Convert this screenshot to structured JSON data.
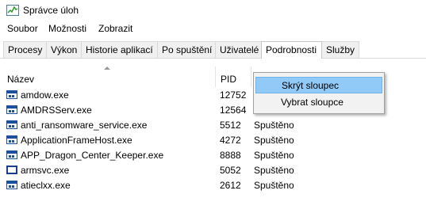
{
  "window": {
    "title": "Správce úloh"
  },
  "menu": [
    "Soubor",
    "Možnosti",
    "Zobrazit"
  ],
  "tabs": [
    "Procesy",
    "Výkon",
    "Historie aplikací",
    "Po spuštění",
    "Uživatelé",
    "Podrobnosti",
    "Služby"
  ],
  "active_tab": "Podrobnosti",
  "columns": {
    "name": "Název",
    "pid": "PID"
  },
  "context_menu": {
    "items": [
      "Skrýt sloupec",
      "Vybrat sloupce"
    ],
    "highlighted": "Skrýt sloupec"
  },
  "rows": [
    {
      "icon": "app-window-icon",
      "name": "amdow.exe",
      "pid": "12752",
      "status": ""
    },
    {
      "icon": "app-window-icon",
      "name": "AMDRSServ.exe",
      "pid": "12564",
      "status": ""
    },
    {
      "icon": "app-window-icon",
      "name": "anti_ransomware_service.exe",
      "pid": "5512",
      "status": "Spuštěno"
    },
    {
      "icon": "app-window-icon",
      "name": "ApplicationFrameHost.exe",
      "pid": "4272",
      "status": "Spuštěno"
    },
    {
      "icon": "app-window-icon",
      "name": "APP_Dragon_Center_Keeper.exe",
      "pid": "8888",
      "status": "Spuštěno"
    },
    {
      "icon": "generic-window-icon",
      "name": "armsvc.exe",
      "pid": "5052",
      "status": "Spuštěno"
    },
    {
      "icon": "app-window-icon",
      "name": "atieclxx.exe",
      "pid": "2612",
      "status": "Spuštěno"
    }
  ]
}
